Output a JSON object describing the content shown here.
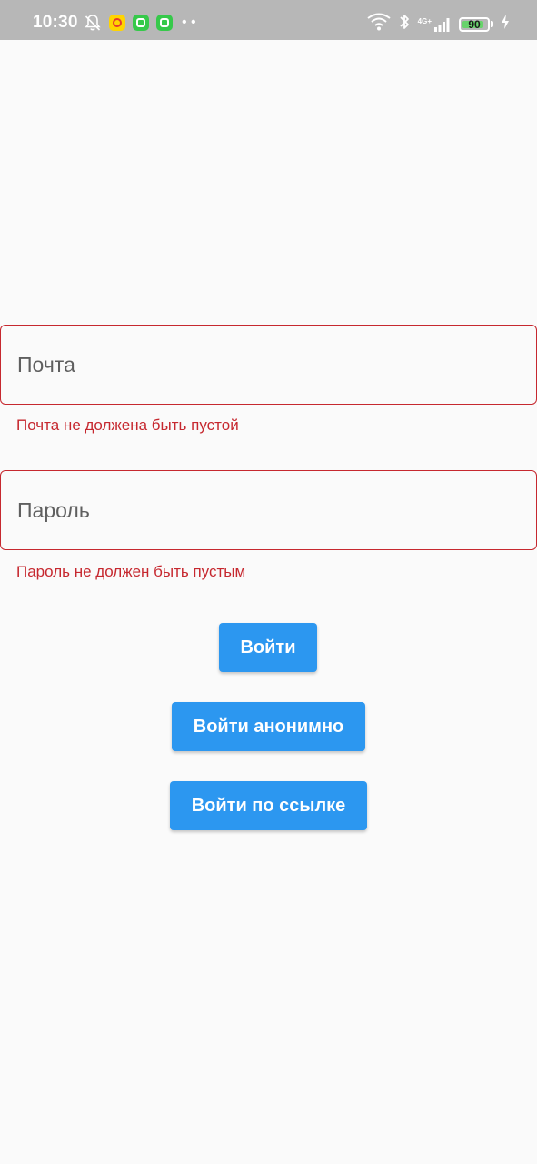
{
  "status_bar": {
    "time": "10:30",
    "network": "4G+",
    "battery_level": "90",
    "battery_fraction": 0.9,
    "icons": [
      "bell-off-icon",
      "app-icon",
      "app-icon",
      "app-icon",
      "more-icon",
      "wifi-icon",
      "bluetooth-icon",
      "signal-icon",
      "battery-icon",
      "charging-icon"
    ]
  },
  "form": {
    "email": {
      "placeholder": "Почта",
      "value": "",
      "error": "Почта не должена быть пустой"
    },
    "password": {
      "placeholder": "Пароль",
      "value": "",
      "error": "Пароль не должен быть пустым"
    }
  },
  "buttons": {
    "login": "Войти",
    "login_anonymous": "Войти анонимно",
    "login_link": "Войти по ссылке"
  },
  "colors": {
    "error": "#c6282f",
    "primary": "#2c97f0",
    "background": "#fafafa",
    "status_bar": "#b7b7b7"
  }
}
